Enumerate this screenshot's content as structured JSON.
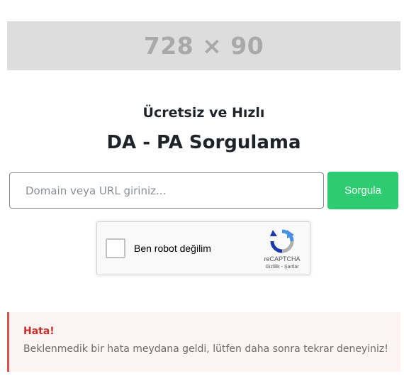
{
  "ad": {
    "label": "728 × 90"
  },
  "header": {
    "subtitle": "Ücretsiz ve Hızlı",
    "title": "DA - PA Sorgulama"
  },
  "search": {
    "placeholder": "Domain veya URL giriniz...",
    "value": "",
    "button_label": "Sorgula"
  },
  "recaptcha": {
    "label": "Ben robot değilim",
    "brand": "reCAPTCHA",
    "privacy_link": "Gizlilik",
    "separator": " - ",
    "terms_link": "Şartlar",
    "checked": false,
    "icon": "recaptcha-logo-icon"
  },
  "alert": {
    "title": "Hata!",
    "message": "Beklenmedik bir hata meydana geldi, lütfen daha sonra tekrar deneyiniz!",
    "color": "#d9534f"
  },
  "colors": {
    "accent": "#2ecc71",
    "error": "#d9534f"
  }
}
